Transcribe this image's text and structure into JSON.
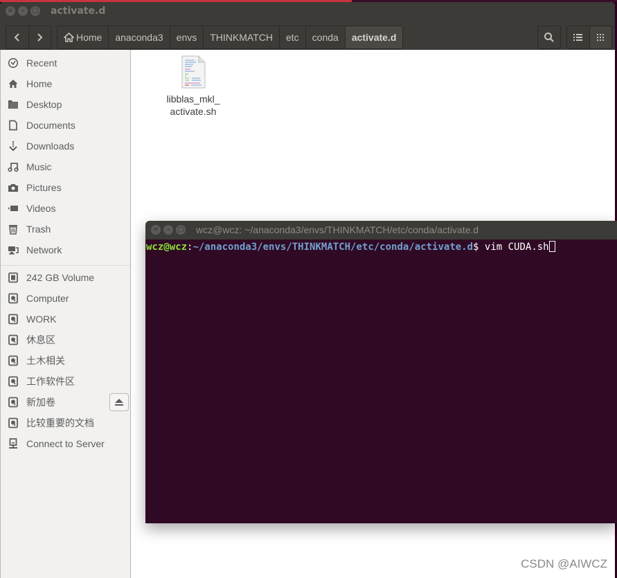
{
  "file_manager": {
    "title": "activate.d",
    "window_controls": [
      "close",
      "minimize",
      "maximize"
    ],
    "nav": {
      "back_icon": "chevron-left-icon",
      "forward_icon": "chevron-right-icon"
    },
    "breadcrumbs": [
      {
        "label": "Home",
        "icon": "home-icon"
      },
      {
        "label": "anaconda3"
      },
      {
        "label": "envs"
      },
      {
        "label": "THINKMATCH"
      },
      {
        "label": "etc"
      },
      {
        "label": "conda"
      },
      {
        "label": "activate.d",
        "active": true
      }
    ],
    "toolbar": {
      "search_icon": "search-icon",
      "list_view_icon": "list-view-icon",
      "grid_view_icon": "grid-view-icon"
    },
    "sidebar": {
      "places": [
        {
          "label": "Recent",
          "icon": "clock-icon"
        },
        {
          "label": "Home",
          "icon": "home-icon"
        },
        {
          "label": "Desktop",
          "icon": "folder-icon"
        },
        {
          "label": "Documents",
          "icon": "document-icon"
        },
        {
          "label": "Downloads",
          "icon": "download-icon"
        },
        {
          "label": "Music",
          "icon": "music-icon"
        },
        {
          "label": "Pictures",
          "icon": "camera-icon"
        },
        {
          "label": "Videos",
          "icon": "video-icon"
        },
        {
          "label": "Trash",
          "icon": "trash-icon"
        },
        {
          "label": "Network",
          "icon": "network-icon"
        }
      ],
      "devices": [
        {
          "label": "242 GB Volume",
          "icon": "chip-drive-icon"
        },
        {
          "label": "Computer",
          "icon": "drive-icon"
        },
        {
          "label": "WORK",
          "icon": "drive-icon"
        },
        {
          "label": "休息区",
          "icon": "drive-icon"
        },
        {
          "label": "土木相关",
          "icon": "drive-icon"
        },
        {
          "label": "工作软件区",
          "icon": "drive-icon"
        },
        {
          "label": "新加卷",
          "icon": "drive-icon",
          "ejectable": true
        },
        {
          "label": "比较重要的文档",
          "icon": "drive-icon"
        },
        {
          "label": "Connect to Server",
          "icon": "server-icon"
        }
      ]
    },
    "files": [
      {
        "name_line1": "libblas_mkl_",
        "name_line2": "activate.sh",
        "type": "shell-script"
      }
    ]
  },
  "terminal": {
    "title": "wcz@wcz: ~/anaconda3/envs/THINKMATCH/etc/conda/activate.d",
    "prompt_user": "wcz@wcz",
    "prompt_sep": ":",
    "prompt_path": "~/anaconda3/envs/THINKMATCH/etc/conda/activate.d",
    "prompt_symbol": "$ ",
    "command": "vim CUDA.sh",
    "colors": {
      "background": "#300a24",
      "user": "#8ae234",
      "path": "#729fcf",
      "text": "#ffffff"
    }
  },
  "watermark": "CSDN @AIWCZ"
}
